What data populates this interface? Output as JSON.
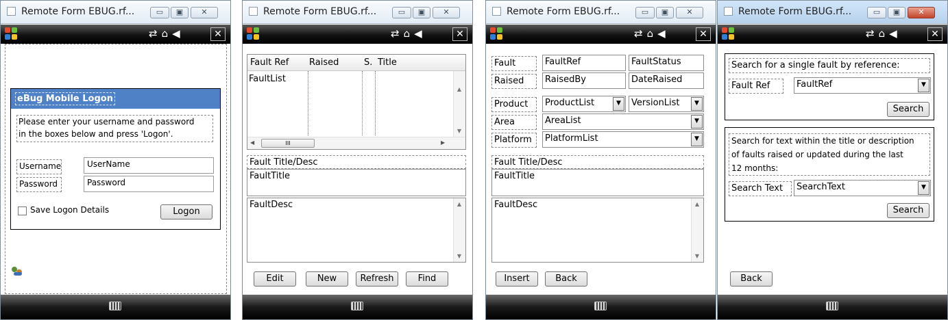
{
  "windows": [
    {
      "title": "Remote Form EBUG.rf...",
      "logon": {
        "header": "eBug Mobile Logon",
        "instruction_line1": "Please enter your username and password",
        "instruction_line2": "in the boxes below and press 'Logon'.",
        "username_label": "Username",
        "username_value": "UserName",
        "password_label": "Password",
        "password_value": "Password",
        "save_label": "Save Logon Details",
        "logon_button": "Logon"
      }
    },
    {
      "title": "Remote Form EBUG.rf...",
      "fault_list": {
        "columns": [
          "Fault Ref",
          "Raised",
          "S.",
          "Title"
        ],
        "list_name": "FaultList",
        "title_desc_label": "Fault Title/Desc",
        "title_value": "FaultTitle",
        "desc_value": "FaultDesc",
        "hscroll_grip": "III",
        "buttons": [
          "Edit",
          "New",
          "Refresh",
          "Find"
        ]
      }
    },
    {
      "title": "Remote Form EBUG.rf...",
      "fault_edit": {
        "fault_label": "Fault",
        "fault_ref": "FaultRef",
        "fault_status": "FaultStatus",
        "raised_label": "Raised",
        "raised_by": "RaisedBy",
        "date_raised": "DateRaised",
        "product_label": "Product",
        "product_list": "ProductList",
        "version_list": "VersionList",
        "area_label": "Area",
        "area_list": "AreaList",
        "platform_label": "Platform",
        "platform_list": "PlatformList",
        "title_desc_label": "Fault Title/Desc",
        "title_value": "FaultTitle",
        "desc_value": "FaultDesc",
        "insert_button": "Insert",
        "back_button": "Back"
      }
    },
    {
      "title": "Remote Form EBUG.rf...",
      "search": {
        "single_text": "Search for a single fault by reference:",
        "fault_ref_label": "Fault Ref",
        "fault_ref_value": "FaultRef",
        "search_button_1": "Search",
        "text_line1": "Search for text within the title or description",
        "text_line2": "of faults raised or updated during the last",
        "text_line3": "12 months:",
        "search_text_label": "Search Text",
        "search_text_value": "SearchText",
        "search_button_2": "Search",
        "back_button": "Back"
      }
    }
  ],
  "colors": {
    "logon_header_bg": "#4f81c7",
    "flag_red": "#e6482b",
    "flag_green": "#6cbf3b",
    "flag_blue": "#2f7fd8",
    "flag_yellow": "#f6c325"
  },
  "icons": {
    "window_icon": "window-icon",
    "minimize": "minimize-icon",
    "maximize": "maximize-icon",
    "close": "close-icon",
    "start": "windows-flag-icon",
    "connectivity": "connectivity-icon",
    "battery": "battery-icon",
    "volume": "volume-icon",
    "keyboard": "keyboard-icon",
    "users": "users-icon"
  },
  "glyphs": {
    "minimize": "▭",
    "maximize": "▣",
    "close": "✕",
    "tray": "⇄⌂◀",
    "dropdown": "▼",
    "scroll_up": "▲",
    "scroll_down": "▼",
    "scroll_left": "◀",
    "scroll_right": "▶"
  }
}
